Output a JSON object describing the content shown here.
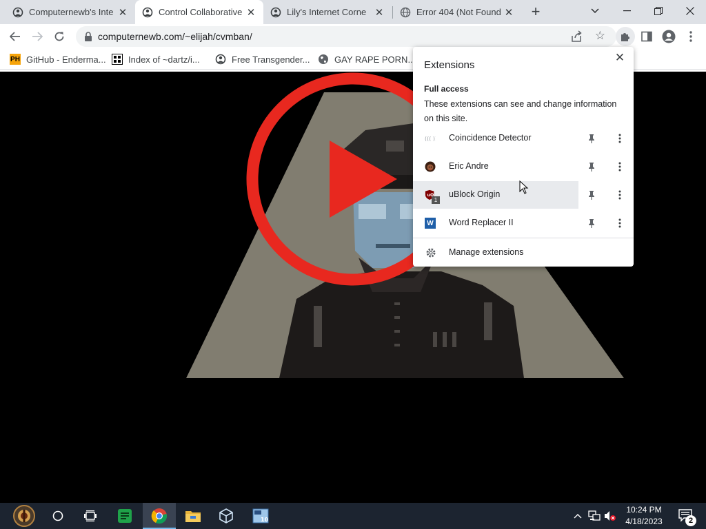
{
  "tabs": [
    {
      "title": "Computernewb's Inte",
      "active": false
    },
    {
      "title": "Control Collaborative",
      "active": true
    },
    {
      "title": "Lily's Internet Corne",
      "active": false
    },
    {
      "title": "Error 404 (Not Found",
      "active": false
    }
  ],
  "toolbar": {
    "url": "computernewb.com/~elijah/cvmban/"
  },
  "bookmarks": [
    {
      "label": "GitHub - Enderma...",
      "icon": "ph-icon",
      "icon_text": "PH"
    },
    {
      "label": "Index of ~dartz/i...",
      "icon": "folder-index-icon"
    },
    {
      "label": "Free Transgender...",
      "icon": "site-icon"
    },
    {
      "label": "GAY RAPE PORN...",
      "icon": "globe-icon"
    }
  ],
  "extensions_popup": {
    "title": "Extensions",
    "section_heading": "Full access",
    "section_description": "These extensions can see and change information on this site.",
    "items": [
      {
        "name": "Coincidence Detector",
        "icon": "parentheses-icon",
        "hovered": false
      },
      {
        "name": "Eric Andre",
        "icon": "face-icon",
        "hovered": false
      },
      {
        "name": "uBlock Origin",
        "icon": "ublock-shield-icon",
        "badge": "1",
        "hovered": true
      },
      {
        "name": "Word Replacer II",
        "icon": "word-replacer-icon",
        "icon_text": "W",
        "hovered": false
      }
    ],
    "manage_label": "Manage extensions"
  },
  "taskbar": {
    "time": "10:24 PM",
    "date": "4/18/2023",
    "notification_count": "2"
  },
  "colors": {
    "play_red": "#e8281f",
    "tabstrip_bg": "#dee1e6",
    "taskbar_bg": "#1c2430",
    "accent_blue": "#76b9ed"
  }
}
